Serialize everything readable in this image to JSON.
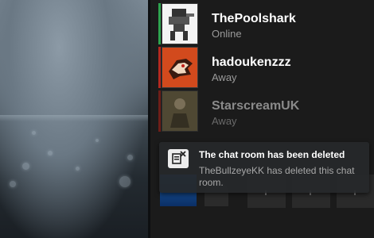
{
  "friends": [
    {
      "name": "ThePoolshark",
      "status": "Online",
      "status_color": "#2ea44f"
    },
    {
      "name": "hadoukenzzz",
      "status": "Away",
      "status_color": "#b5281f"
    },
    {
      "name": "StarscreamUK",
      "status": "Away",
      "status_color": "#b5281f"
    }
  ],
  "notification": {
    "title": "The chat room has been deleted",
    "body": "TheBullzeyeKK has deleted this chat room.",
    "icon": "chat-deleted-icon"
  },
  "colors": {
    "online": "#2ea44f",
    "away": "#b5281f",
    "panel": "#1b1b1b"
  }
}
